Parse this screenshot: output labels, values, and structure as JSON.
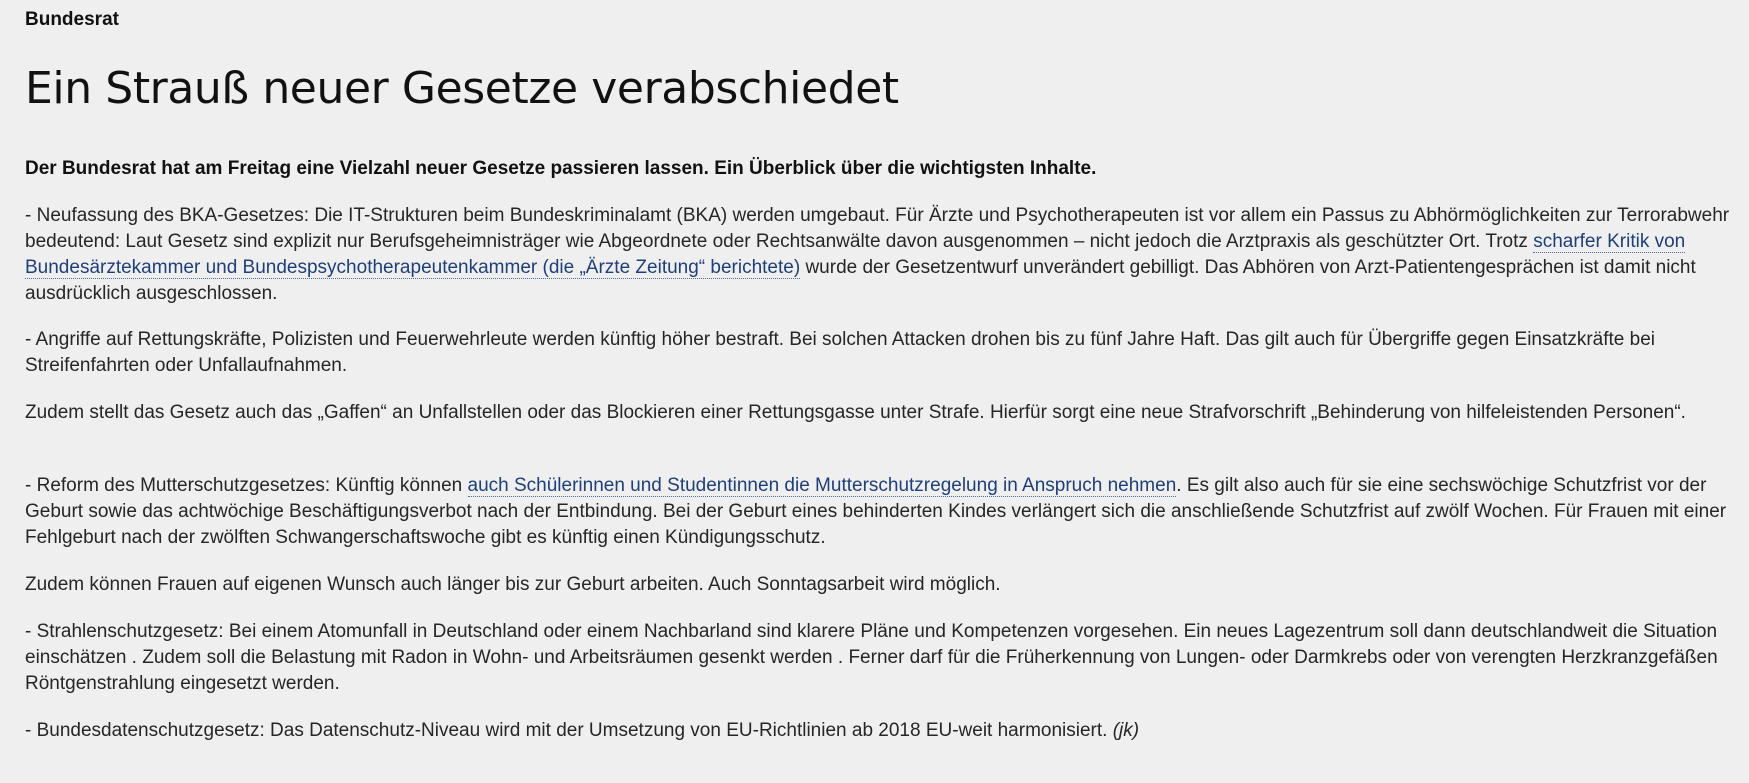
{
  "article": {
    "kicker": "Bundesrat",
    "headline": "Ein Strauß neuer Gesetze verabschiedet",
    "lead": "Der Bundesrat hat am Freitag eine Vielzahl neuer Gesetze passieren lassen. Ein Überblick über die wichtigsten Inhalte.",
    "p1": {
      "before": "- Neufassung des BKA-Gesetzes: Die IT-Strukturen beim Bundeskriminalamt (BKA) werden umgebaut. Für Ärzte und Psychotherapeuten ist vor allem ein Passus zu Abhörmöglichkeiten zur Terrorabwehr bedeutend: Laut Gesetz sind explizit nur Berufsgeheimnisträger wie Abgeordnete oder Rechtsanwälte davon ausgenommen – nicht jedoch die Arztpraxis als geschützter Ort. Trotz ",
      "link": "scharfer Kritik von Bundesärztekammer und Bundespsychotherapeutenkammer (die „Ärzte Zeitung“ berichtete)",
      "after": " wurde der Gesetzentwurf unverändert gebilligt. Das Abhören von Arzt-Patienten­gesprächen ist damit nicht ausdrücklich ausgeschlossen."
    },
    "p2": "- Angriffe auf Rettungskräfte, Polizisten und Feuerwehrleute werden künftig höher bestraft. Bei solchen Attacken drohen bis zu fünf Jahre Haft. Das gilt auch für Übergriffe gegen Einsatzkräfte bei Streifenfahrten oder Unfallaufnahmen.",
    "p3": "Zudem stellt das Gesetz auch das „Gaffen“ an Unfallstellen oder das Blockieren einer Rettungsgasse unter Strafe. Hierfür sorgt eine neue Strafvorschrift „Behinderung von hilfeleistenden Personen“.",
    "p4": {
      "before": "- Reform des Mutterschutzgesetzes: Künftig können ",
      "link": "auch Schülerinnen und Studentinnen die Mutterschutzregelung in Anspruch nehmen",
      "after": ". Es gilt also auch für sie eine sechswöchige Schutzfrist vor der Geburt sowie das achtwöchige Beschäftigungsverbot nach der Entbindung. Bei der Geburt eines behinderten Kindes verlängert sich die anschließende Schutzfrist auf zwölf Wochen. Für Frauen mit einer Fehlgeburt nach der zwölften Schwangerschaftswoche gibt es künftig einen Kündigungsschutz."
    },
    "p5": "Zudem können Frauen auf eigenen Wunsch auch länger bis zur Geburt arbeiten. Auch Sonntagsarbeit wird möglich.",
    "p6": "- Strahlenschutzgesetz: Bei einem Atomunfall in Deutschland oder einem Nachbarland sind klarere Pläne und Kompetenzen vorgesehen. Ein neues Lagezentrum soll dann deutschlandweit die Situation einschätzen . Zudem soll die Belastung mit Radon in Wohn- und Arbeitsräumen gesenkt werden . Ferner darf für die Früherkennung von Lungen- oder Darmkrebs oder von verengten Herzkranzgefäßen Röntgenstrahlung eingesetzt werden.",
    "p7": {
      "text": "- Bundesdatenschutzgesetz: Das Datenschutz-Niveau wird mit der Umsetzung von EU-Richtlinien ab 2018 EU-weit harmonisiert. ",
      "author": "(jk)"
    }
  },
  "colors": {
    "background": "#efefef",
    "text": "#262626",
    "link": "#1e3f7a"
  }
}
